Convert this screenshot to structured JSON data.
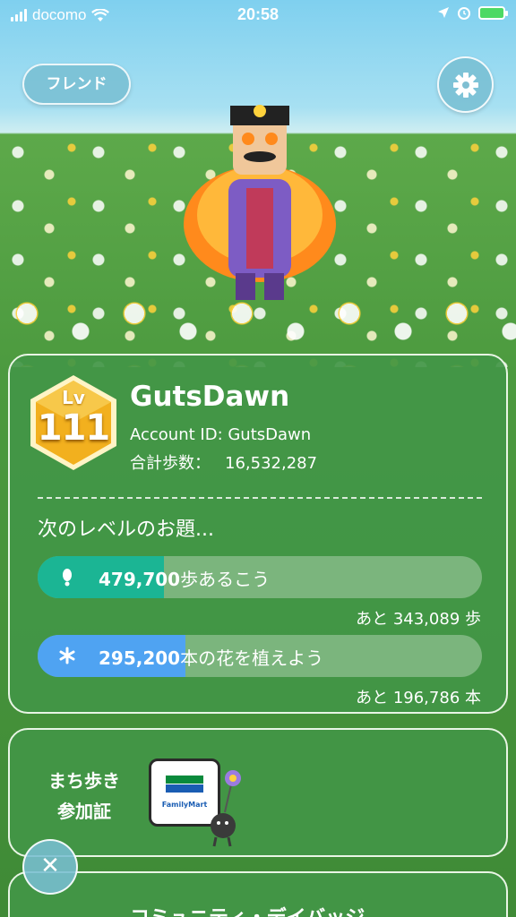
{
  "status_bar": {
    "carrier": "docomo",
    "time": "20:58"
  },
  "top": {
    "friend_label": "フレンド"
  },
  "profile": {
    "level_prefix": "Lv",
    "level": "111",
    "username": "GutsDawn",
    "account_id": "Account ID: GutsDawn",
    "total_steps_label": "合計歩数：",
    "total_steps_value": "16,532,287"
  },
  "next_level": {
    "title": "次のレベルのお題...",
    "tasks": [
      {
        "icon": "footprint-icon",
        "target": "479,700",
        "unit_text": "歩あるこう",
        "remaining": "あと 343,089 歩",
        "progress_fraction": 0.285,
        "color": "#1bb594"
      },
      {
        "icon": "flower-icon",
        "target": "295,200",
        "unit_text": "本の花を植えよう",
        "remaining": "あと 196,786 本",
        "progress_fraction": 0.333,
        "color": "#4fa3f2"
      }
    ]
  },
  "walk_card": {
    "label_line1": "まち歩き",
    "label_line2": "参加証",
    "badge_text": "FamilyMart"
  },
  "community_card": {
    "title": "コミュニティ・デイバッジ"
  },
  "colors": {
    "card_green": "#42964a",
    "level_gold": "#f2b01e"
  }
}
